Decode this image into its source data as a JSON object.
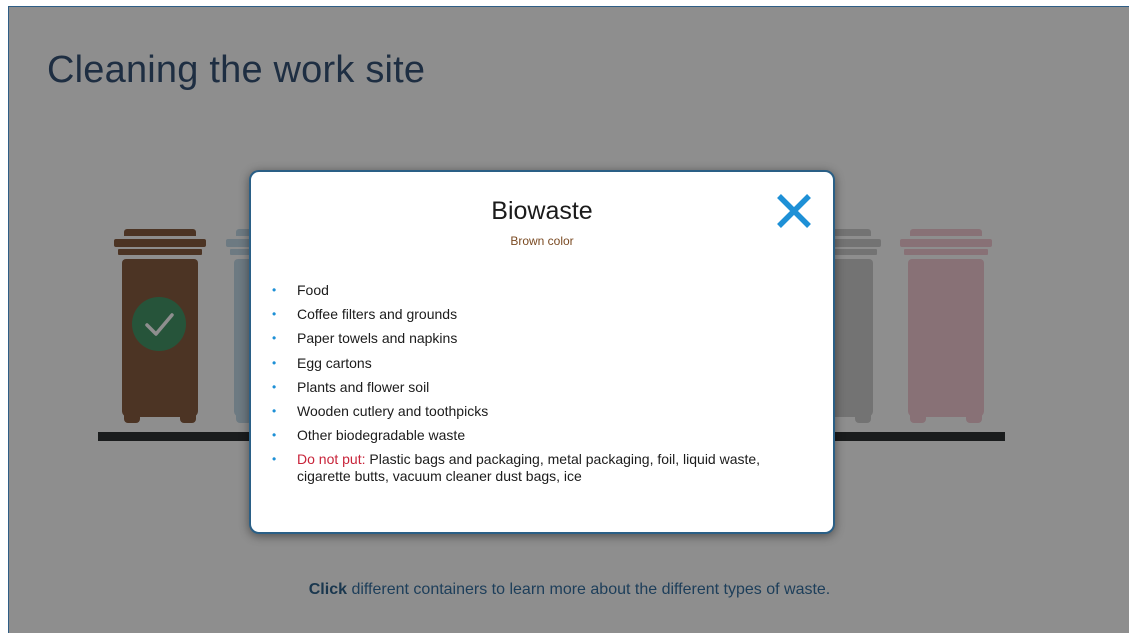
{
  "page": {
    "title": "Cleaning the work site",
    "hint_bold": "Click",
    "hint_rest": " different containers to learn more about the different types of waste."
  },
  "bins": [
    {
      "name": "Biowaste",
      "color": "#7b4a2a",
      "selected": true
    },
    {
      "name": "bin-2",
      "color": "#bdd6e6",
      "selected": false
    },
    {
      "name": "bin-grey",
      "color": "#c9c9c9",
      "selected": false
    },
    {
      "name": "bin-pink",
      "color": "#f2c4cf",
      "selected": false
    }
  ],
  "modal": {
    "title": "Biowaste",
    "subtitle": "Brown color",
    "items": [
      "Food",
      "Coffee filters and grounds",
      "Paper towels and napkins",
      "Egg cartons",
      "Plants and flower soil",
      "Wooden cutlery and toothpicks",
      "Other biodegradable waste"
    ],
    "warning_label": "Do not put:",
    "warning_text": " Plastic bags and packaging, metal packaging, foil, liquid waste, cigarette butts, vacuum cleaner dust bags, ice",
    "close_icon": "close-x-icon"
  },
  "colors": {
    "accent": "#1e90d6",
    "title": "#1f3f66",
    "warning": "#c8243a",
    "brown": "#7a4a22"
  }
}
